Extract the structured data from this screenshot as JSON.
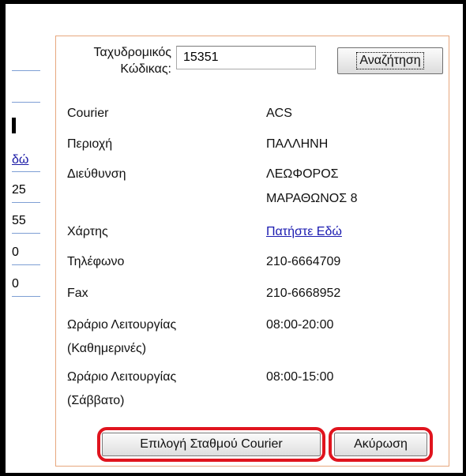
{
  "background": {
    "fragments": [
      "δώ",
      "25",
      "55",
      "0",
      "0"
    ]
  },
  "search": {
    "zip_label": "Ταχυδρομικός Κώδικας:",
    "zip_value": "15351",
    "button_label": "Αναζήτηση"
  },
  "details": {
    "courier_label": "Courier",
    "courier_value": "ACS",
    "area_label": "Περιοχή",
    "area_value": "ΠΑΛΛΗΝΗ",
    "address_label": "Διεύθυνση",
    "address_line1": "ΛΕΩΦΟΡΟΣ",
    "address_line2": "ΜΑΡΑΘΩΝΟΣ 8",
    "map_label": "Χάρτης",
    "map_link": "Πατήστε Εδώ",
    "phone_label": "Τηλέφωνο",
    "phone_value": "210-6664709",
    "fax_label": "Fax",
    "fax_value": "210-6668952",
    "hours_weekday_label_1": "Ωράριο Λειτουργίας",
    "hours_weekday_label_2": "(Καθημερινές)",
    "hours_weekday_value": "08:00-20:00",
    "hours_saturday_label_1": "Ωράριο Λειτουργίας",
    "hours_saturday_label_2": "(Σάββατο)",
    "hours_saturday_value": "08:00-15:00"
  },
  "actions": {
    "select_label": "Επιλογή Σταθμού Courier",
    "cancel_label": "Ακύρωση",
    "highlight_color": "#e0141e"
  }
}
